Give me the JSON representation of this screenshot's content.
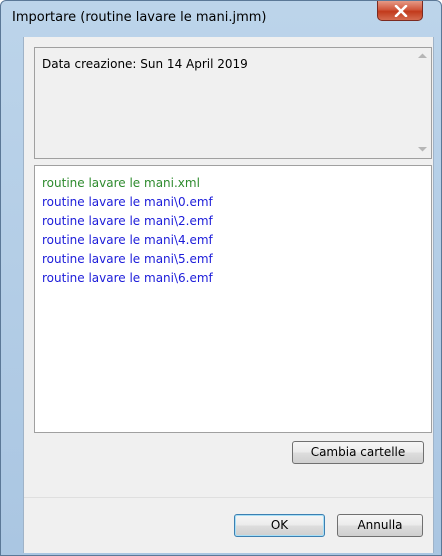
{
  "window": {
    "title": "Importare (routine lavare le mani.jmm)",
    "close_glyph": "X"
  },
  "info": {
    "text": "Data creazione: Sun 14 April 2019"
  },
  "file_list": {
    "items": [
      {
        "label": "routine lavare le mani.xml",
        "color": "#2e8b2e"
      },
      {
        "label": "routine lavare le mani\\0.emf",
        "color": "#1c1cd9"
      },
      {
        "label": "routine lavare le mani\\2.emf",
        "color": "#1c1cd9"
      },
      {
        "label": "routine lavare le mani\\4.emf",
        "color": "#1c1cd9"
      },
      {
        "label": "routine lavare le mani\\5.emf",
        "color": "#1c1cd9"
      },
      {
        "label": "routine lavare le mani\\6.emf",
        "color": "#1c1cd9"
      }
    ]
  },
  "buttons": {
    "change_folders": "Cambia cartelle",
    "ok": "OK",
    "cancel": "Annulla"
  },
  "icons": {
    "close": "close-icon",
    "scroll_up": "scroll-up-arrow-icon",
    "scroll_down": "scroll-down-arrow-icon"
  }
}
